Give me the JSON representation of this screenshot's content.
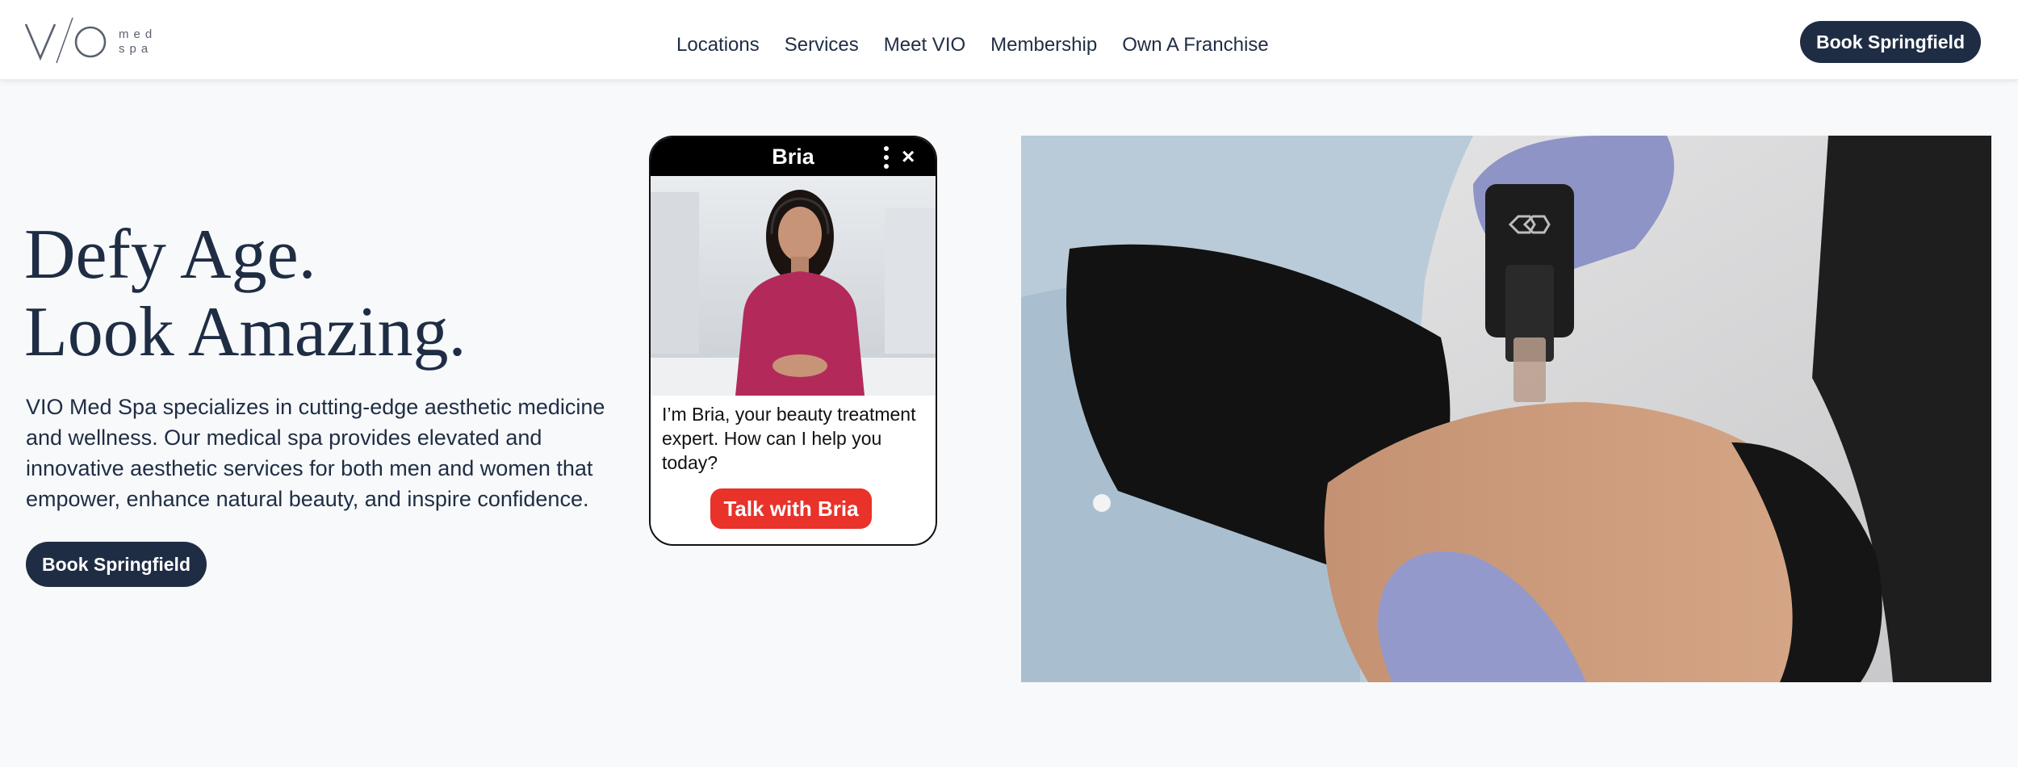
{
  "header": {
    "logo_text": "VIO",
    "logo_sub_line1": "med",
    "logo_sub_line2": "spa",
    "nav": [
      "Locations",
      "Services",
      "Meet VIO",
      "Membership",
      "Own A Franchise"
    ],
    "book_label": "Book Springfield"
  },
  "hero": {
    "title_line1": "Defy Age.",
    "title_line2": "Look Amazing.",
    "description": "VIO Med Spa specializes in cutting-edge aesthetic medicine and wellness. Our medical spa provides elevated and innovative aesthetic services for both men and women that empower, enhance natural beauty, and inspire confidence.",
    "book_label": "Book Springfield"
  },
  "chat_widget": {
    "name": "Bria",
    "message": "I’m Bria, your beauty treatment expert. How can I help you today?",
    "cta_label": "Talk with Bria"
  },
  "colors": {
    "navy": "#1f2d44",
    "cta_red": "#e8322a",
    "background": "#f7f9fb"
  },
  "icons": {
    "more": "vertical-dots-icon",
    "close": "close-icon"
  }
}
